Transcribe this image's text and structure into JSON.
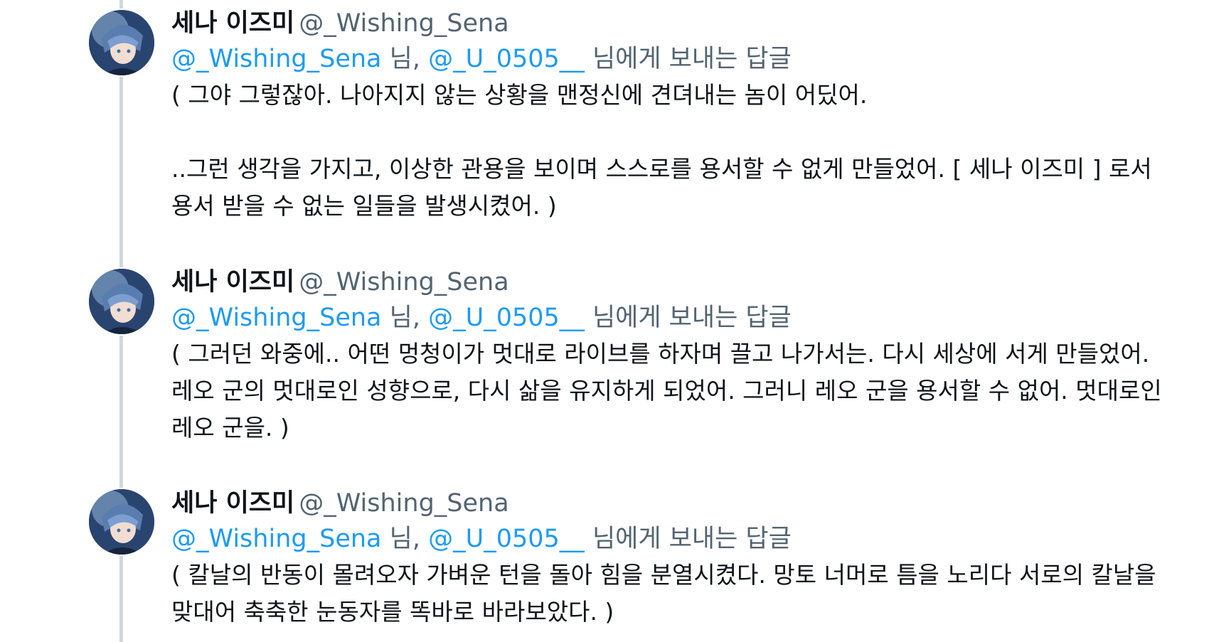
{
  "colors": {
    "accent": "#1d9bf0",
    "muted": "#536471",
    "text": "#0f1419",
    "thread_line": "#cfd9de"
  },
  "tweets": [
    {
      "name": "세나 이즈미",
      "handle": "@_Wishing_Sena",
      "mention1": "@_Wishing_Sena",
      "sep1": "님,",
      "mention2": "@_U_0505__",
      "reply_suffix": "님에게 보내는 답글",
      "lines": [
        "( 그야 그렇잖아. 나아지지 않는 상황을 맨정신에 견뎌내는 놈이 어딨어.",
        "..그런 생각을 가지고, 이상한 관용을 보이며 스스로를 용서할 수 없게 만들었어. [ 세나 이즈미 ] 로서",
        "용서 받을 수 없는 일들을 발생시켰어. )"
      ]
    },
    {
      "name": "세나 이즈미",
      "handle": "@_Wishing_Sena",
      "mention1": "@_Wishing_Sena",
      "sep1": "님,",
      "mention2": "@_U_0505__",
      "reply_suffix": "님에게 보내는 답글",
      "lines": [
        "( 그러던 와중에.. 어떤 멍청이가 멋대로 라이브를 하자며 끌고 나가서는. 다시 세상에 서게 만들었어.",
        "레오 군의 멋대로인 성향으로, 다시 삶을 유지하게 되었어. 그러니 레오 군을 용서할 수 없어. 멋대로인",
        "레오 군을. )"
      ]
    },
    {
      "name": "세나 이즈미",
      "handle": "@_Wishing_Sena",
      "mention1": "@_Wishing_Sena",
      "sep1": "님,",
      "mention2": "@_U_0505__",
      "reply_suffix": "님에게 보내는 답글",
      "lines": [
        "( 칼날의 반동이 몰려오자 가벼운 턴을 돌아 힘을 분열시켰다. 망토 너머로 틈을 노리다 서로의 칼날을",
        "맞대어 축축한 눈동자를 똑바로 바라보았다. )"
      ]
    }
  ]
}
